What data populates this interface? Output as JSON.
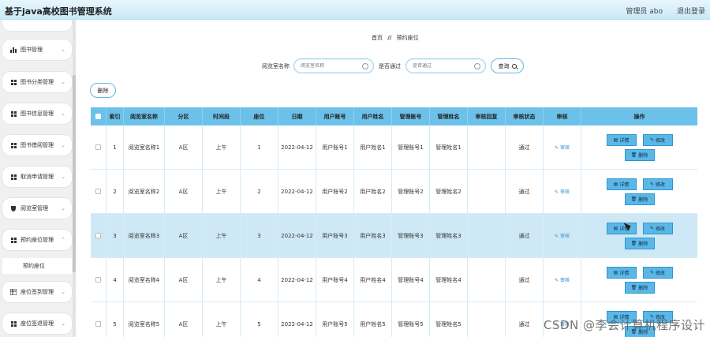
{
  "header": {
    "title": "基于java高校图书管理系统",
    "user": "管理员 abo",
    "logout": "退出登录"
  },
  "sidebar": {
    "items": [
      {
        "label": "图书管理",
        "icon": "bar-chart-icon"
      },
      {
        "label": "图书分类管理",
        "icon": "grid-icon"
      },
      {
        "label": "图书信息管理",
        "icon": "grid-icon"
      },
      {
        "label": "图书借阅管理",
        "icon": "grid-icon"
      },
      {
        "label": "取消申请管理",
        "icon": "grid-icon"
      },
      {
        "label": "阅览室管理",
        "icon": "shield-icon"
      },
      {
        "label": "预约座位管理",
        "icon": "grid-icon"
      },
      {
        "label": "座位签到管理",
        "icon": "table-icon"
      },
      {
        "label": "座位签退管理",
        "icon": "grid-icon"
      }
    ],
    "sub_item": "预约座位"
  },
  "breadcrumb": {
    "home": "首页",
    "sep": "//",
    "current": "预约座位"
  },
  "search": {
    "room_label": "阅览室名称",
    "room_placeholder": "阅览室名称",
    "pass_label": "是否通过",
    "pass_placeholder": "是否通过",
    "query": "查询"
  },
  "toolbar": {
    "delete": "删除"
  },
  "table": {
    "columns": [
      "索引",
      "阅览室名称",
      "分区",
      "时间段",
      "座位",
      "日期",
      "用户账号",
      "用户姓名",
      "管理账号",
      "管理姓名",
      "审核回复",
      "审核状态",
      "审核",
      "操作"
    ],
    "rows": [
      {
        "idx": "1",
        "room": "阅览室名称1",
        "zone": "A区",
        "period": "上午",
        "seat": "1",
        "date": "2022-04-12",
        "uacc": "用户账号1",
        "uname": "用户姓名1",
        "macc": "管理账号1",
        "mname": "管理姓名1",
        "reply": "",
        "status": "通过",
        "audit": "审核"
      },
      {
        "idx": "2",
        "room": "阅览室名称2",
        "zone": "A区",
        "period": "上午",
        "seat": "2",
        "date": "2022-04-12",
        "uacc": "用户账号2",
        "uname": "用户姓名2",
        "macc": "管理账号2",
        "mname": "管理姓名2",
        "reply": "",
        "status": "通过",
        "audit": "审核"
      },
      {
        "idx": "3",
        "room": "阅览室名称3",
        "zone": "A区",
        "period": "上午",
        "seat": "3",
        "date": "2022-04-12",
        "uacc": "用户账号3",
        "uname": "用户姓名3",
        "macc": "管理账号3",
        "mname": "管理姓名3",
        "reply": "",
        "status": "通过",
        "audit": "审核"
      },
      {
        "idx": "4",
        "room": "阅览室名称4",
        "zone": "A区",
        "period": "上午",
        "seat": "4",
        "date": "2022-04-12",
        "uacc": "用户账号4",
        "uname": "用户姓名4",
        "macc": "管理账号4",
        "mname": "管理姓名4",
        "reply": "",
        "status": "通过",
        "audit": "审核"
      },
      {
        "idx": "5",
        "room": "阅览室名称5",
        "zone": "A区",
        "period": "上午",
        "seat": "5",
        "date": "2022-04-12",
        "uacc": "用户账号5",
        "uname": "用户姓名5",
        "macc": "管理账号5",
        "mname": "管理姓名5",
        "reply": "",
        "status": "通过",
        "audit": "审核"
      }
    ],
    "actions": {
      "detail": "详情",
      "edit": "修改",
      "delete": "删除"
    }
  },
  "watermark": "CSDN @李会计算机程序设计"
}
